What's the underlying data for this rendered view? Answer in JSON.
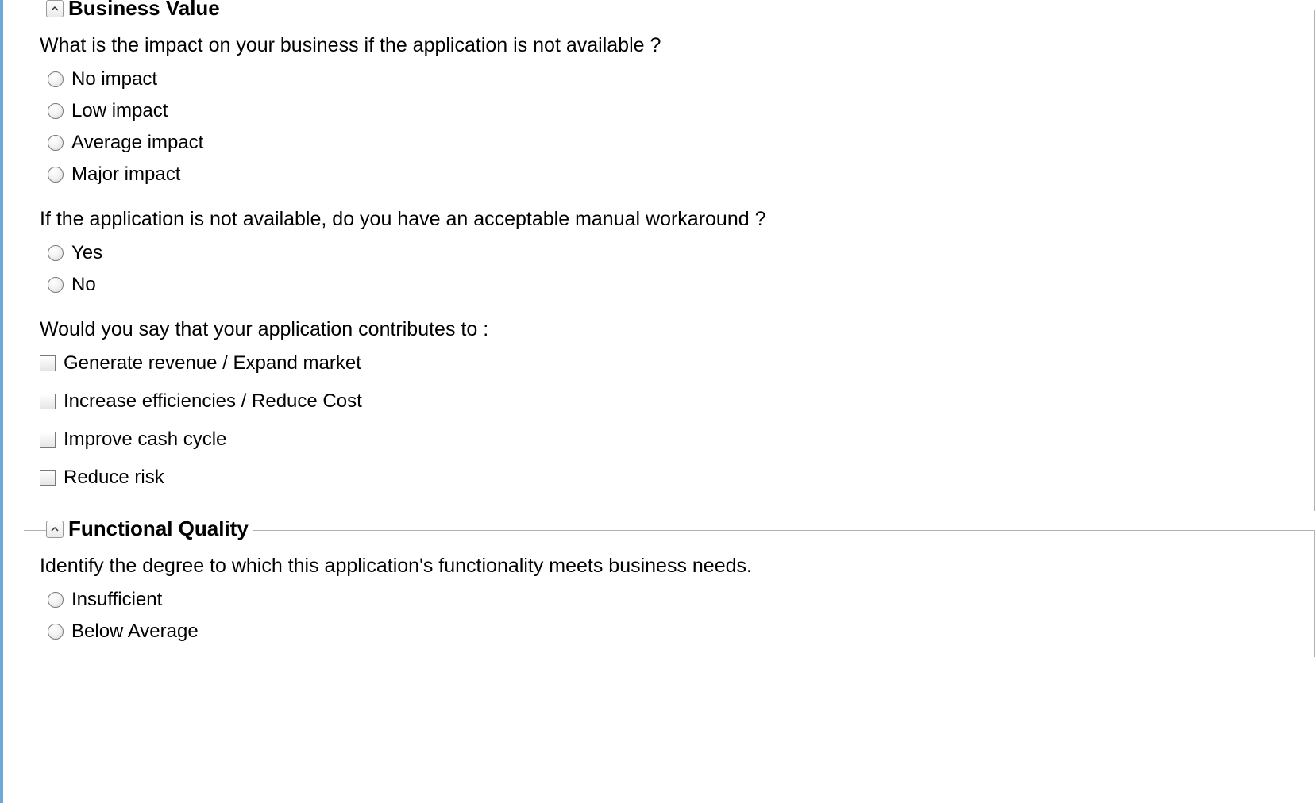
{
  "sections": {
    "business_value": {
      "title": "Business Value",
      "q1": {
        "text": "What is the impact on your business if the application is not available ?",
        "options": [
          "No impact",
          "Low impact",
          "Average impact",
          "Major impact"
        ]
      },
      "q2": {
        "text": "If the application is not available, do you have an acceptable manual workaround ?",
        "options": [
          "Yes",
          "No"
        ]
      },
      "q3": {
        "text": "Would you say that your application contributes to :",
        "options": [
          "Generate revenue / Expand market",
          "Increase efficiencies / Reduce Cost",
          "Improve cash cycle",
          "Reduce risk"
        ]
      }
    },
    "functional_quality": {
      "title": "Functional Quality",
      "q1": {
        "text": "Identify the degree to which this application's functionality meets  business needs.",
        "options": [
          "Insufficient",
          "Below Average"
        ]
      }
    }
  }
}
